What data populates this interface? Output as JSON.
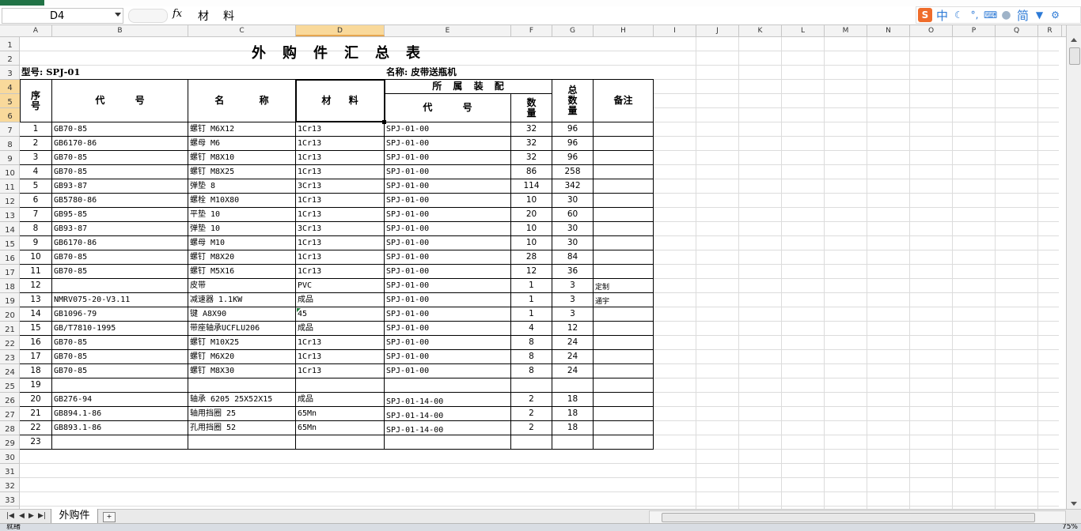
{
  "formula_bar": {
    "name_box": "D4",
    "fx_label": "fx",
    "content": "材料"
  },
  "ime_toolbar": {
    "mode": "中",
    "script": "简"
  },
  "columns": [
    {
      "label": "A",
      "w": 41
    },
    {
      "label": "B",
      "w": 172
    },
    {
      "label": "C",
      "w": 136
    },
    {
      "label": "D",
      "w": 112
    },
    {
      "label": "E",
      "w": 160
    },
    {
      "label": "F",
      "w": 52
    },
    {
      "label": "G",
      "w": 52
    },
    {
      "label": "H",
      "w": 76
    },
    {
      "label": "I",
      "w": 54
    },
    {
      "label": "J",
      "w": 54
    },
    {
      "label": "K",
      "w": 54
    },
    {
      "label": "L",
      "w": 54
    },
    {
      "label": "M",
      "w": 54
    },
    {
      "label": "N",
      "w": 54
    },
    {
      "label": "O",
      "w": 54
    },
    {
      "label": "P",
      "w": 54
    },
    {
      "label": "Q",
      "w": 54
    },
    {
      "label": "R",
      "w": 30
    }
  ],
  "active_column": "D",
  "active_rows": [
    4,
    5,
    6
  ],
  "row_numbers": [
    "1",
    "2",
    "3",
    "4",
    "5",
    "6",
    "7",
    "8",
    "9",
    "10",
    "11",
    "12",
    "13",
    "14",
    "15",
    "16",
    "17",
    "18",
    "19",
    "20",
    "21",
    "22",
    "23",
    "24",
    "25",
    "26",
    "27",
    "28",
    "29",
    "30",
    "31",
    "32",
    "33"
  ],
  "sheet": {
    "title": "外购件汇总表",
    "model": "型号: SPJ-01",
    "name": "名称: 皮带送瓶机",
    "headers": {
      "seq": "序号",
      "code": "代 号",
      "name": "名 称",
      "material": "材 料",
      "assembly": "所 属 装 配",
      "asm_code": "代 号",
      "qty": "数量",
      "total": "总数量",
      "note": "备注"
    },
    "rows": [
      {
        "n": "1",
        "code": "GB70-85",
        "name": "螺钉 M6X12",
        "mat": "1Cr13",
        "asm": "SPJ-01-00",
        "qty": "32",
        "total": "96",
        "note": ""
      },
      {
        "n": "2",
        "code": "GB6170-86",
        "name": "螺母 M6",
        "mat": "1Cr13",
        "asm": "SPJ-01-00",
        "qty": "32",
        "total": "96",
        "note": ""
      },
      {
        "n": "3",
        "code": "GB70-85",
        "name": "螺钉 M8X10",
        "mat": "1Cr13",
        "asm": "SPJ-01-00",
        "qty": "32",
        "total": "96",
        "note": ""
      },
      {
        "n": "4",
        "code": "GB70-85",
        "name": "螺钉 M8X25",
        "mat": "1Cr13",
        "asm": "SPJ-01-00",
        "qty": "86",
        "total": "258",
        "note": ""
      },
      {
        "n": "5",
        "code": "GB93-87",
        "name": "弹垫 8",
        "mat": "3Cr13",
        "asm": "SPJ-01-00",
        "qty": "114",
        "total": "342",
        "note": ""
      },
      {
        "n": "6",
        "code": "GB5780-86",
        "name": "螺栓 M10X80",
        "mat": "1Cr13",
        "asm": "SPJ-01-00",
        "qty": "10",
        "total": "30",
        "note": ""
      },
      {
        "n": "7",
        "code": "GB95-85",
        "name": "平垫 10",
        "mat": "1Cr13",
        "asm": "SPJ-01-00",
        "qty": "20",
        "total": "60",
        "note": ""
      },
      {
        "n": "8",
        "code": "GB93-87",
        "name": "弹垫 10",
        "mat": "3Cr13",
        "asm": "SPJ-01-00",
        "qty": "10",
        "total": "30",
        "note": ""
      },
      {
        "n": "9",
        "code": "GB6170-86",
        "name": "螺母 M10",
        "mat": "1Cr13",
        "asm": "SPJ-01-00",
        "qty": "10",
        "total": "30",
        "note": ""
      },
      {
        "n": "10",
        "code": "GB70-85",
        "name": "螺钉 M8X20",
        "mat": "1Cr13",
        "asm": "SPJ-01-00",
        "qty": "28",
        "total": "84",
        "note": ""
      },
      {
        "n": "11",
        "code": "GB70-85",
        "name": "螺钉 M5X16",
        "mat": "1Cr13",
        "asm": "SPJ-01-00",
        "qty": "12",
        "total": "36",
        "note": ""
      },
      {
        "n": "12",
        "code": "",
        "name": "皮带",
        "mat": "PVC",
        "asm": "SPJ-01-00",
        "qty": "1",
        "total": "3",
        "note": "定制"
      },
      {
        "n": "13",
        "code": "NMRV075-20-V3.11",
        "name": "减速器 1.1KW",
        "mat": "成品",
        "asm": "SPJ-01-00",
        "qty": "1",
        "total": "3",
        "note": "通宇"
      },
      {
        "n": "14",
        "code": "GB1096-79",
        "name": "键 A8X90",
        "mat": "45",
        "asm": "SPJ-01-00",
        "qty": "1",
        "total": "3",
        "note": ""
      },
      {
        "n": "15",
        "code": "GB/T7810-1995",
        "name": "带座轴承UCFLU206",
        "mat": "成品",
        "asm": "SPJ-01-00",
        "qty": "4",
        "total": "12",
        "note": ""
      },
      {
        "n": "16",
        "code": "GB70-85",
        "name": "螺钉 M10X25",
        "mat": "1Cr13",
        "asm": "SPJ-01-00",
        "qty": "8",
        "total": "24",
        "note": ""
      },
      {
        "n": "17",
        "code": "GB70-85",
        "name": "螺钉 M6X20",
        "mat": "1Cr13",
        "asm": "SPJ-01-00",
        "qty": "8",
        "total": "24",
        "note": ""
      },
      {
        "n": "18",
        "code": "GB70-85",
        "name": "螺钉 M8X30",
        "mat": "1Cr13",
        "asm": "SPJ-01-00",
        "qty": "8",
        "total": "24",
        "note": ""
      },
      {
        "n": "19",
        "code": "",
        "name": "",
        "mat": "",
        "asm": "",
        "qty": "",
        "total": "",
        "note": ""
      },
      {
        "n": "20",
        "code": "GB276-94",
        "name": "轴承 6205 25X52X15",
        "mat": "成品",
        "asm": "SPJ-01-14-00",
        "qty": "2",
        "total": "18",
        "note": ""
      },
      {
        "n": "21",
        "code": "GB894.1-86",
        "name": "轴用挡圈 25",
        "mat": "65Mn",
        "asm": "SPJ-01-14-00",
        "qty": "2",
        "total": "18",
        "note": ""
      },
      {
        "n": "22",
        "code": "GB893.1-86",
        "name": "孔用挡圈 52",
        "mat": "65Mn",
        "asm": "SPJ-01-14-00",
        "qty": "2",
        "total": "18",
        "note": ""
      },
      {
        "n": "23",
        "code": "",
        "name": "",
        "mat": "",
        "asm": "",
        "qty": "",
        "total": "",
        "note": ""
      }
    ]
  },
  "sheet_tabs": [
    "外购件"
  ],
  "status": {
    "left": "就绪",
    "zoom": "75%"
  },
  "colors": {
    "accent": "#217346",
    "active_header": "#f9d99b",
    "grid": "#dcdcdc"
  }
}
